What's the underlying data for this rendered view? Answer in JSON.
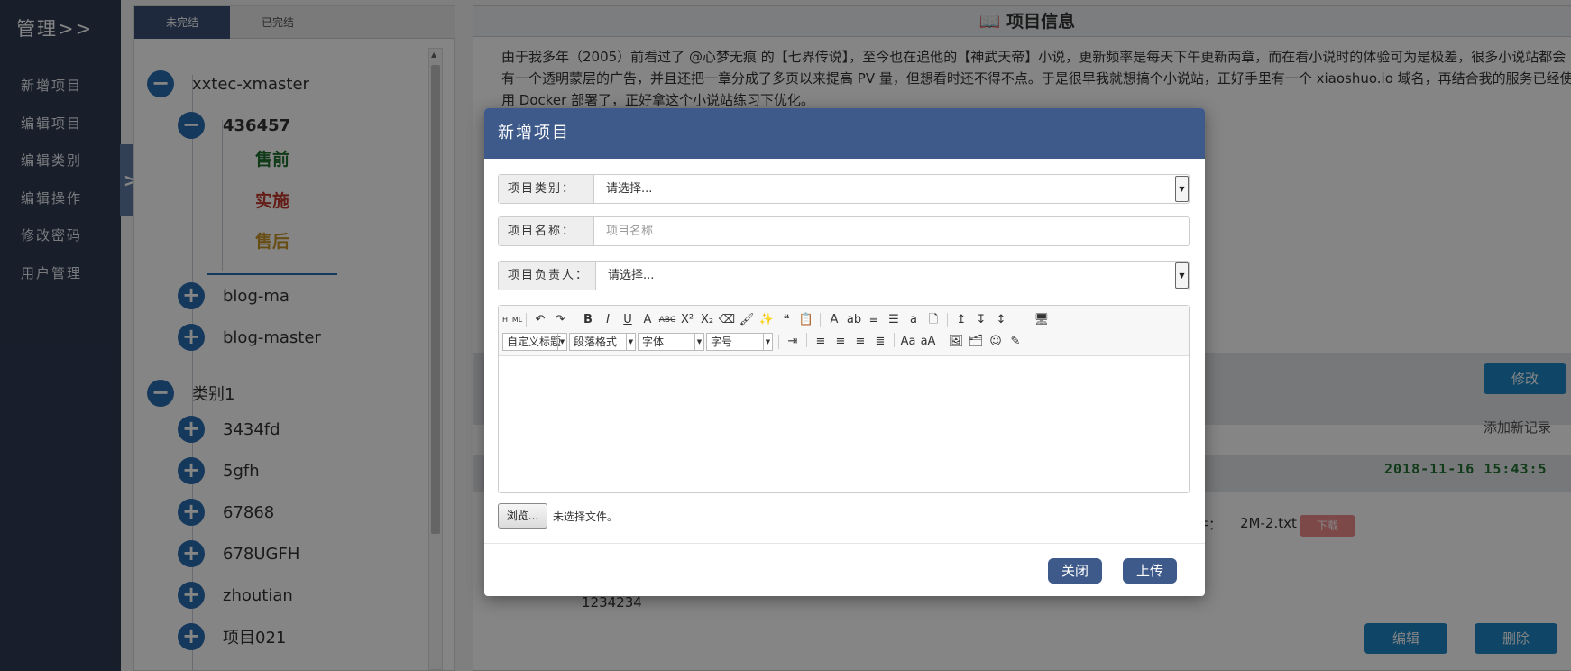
{
  "sidebar": {
    "brand": "管理>>",
    "items": [
      {
        "label": "新增项目"
      },
      {
        "label": "编辑项目"
      },
      {
        "label": "编辑类别"
      },
      {
        "label": "编辑操作"
      },
      {
        "label": "修改密码"
      },
      {
        "label": "用户管理"
      }
    ],
    "toggle_label": ">>"
  },
  "tree_panel": {
    "tabs": [
      {
        "label": "未完结",
        "active": true
      },
      {
        "label": "已完结",
        "active": false
      }
    ],
    "groups": [
      {
        "label": "xxtec-xmaster",
        "expanded": true
      },
      {
        "label": "436457",
        "expanded": true
      },
      {
        "label": "blog-ma"
      },
      {
        "label": "blog-master"
      },
      {
        "label": "类别1",
        "expanded": true
      },
      {
        "label": "3434fd"
      },
      {
        "label": "5gfh"
      },
      {
        "label": "67868"
      },
      {
        "label": "678UGFH"
      },
      {
        "label": "zhoutian"
      },
      {
        "label": "项目021"
      }
    ],
    "leaves": [
      {
        "label": "售前",
        "color": "#1f6f2f"
      },
      {
        "label": "实施",
        "color": "#c0392b"
      },
      {
        "label": "售后",
        "color": "#c8962a"
      }
    ],
    "collapse_glyph": "−",
    "expand_glyph": "+"
  },
  "main": {
    "title": "项目信息",
    "title_icon": "book-icon",
    "description": "由于我多年（2005）前看过了 @心梦无痕 的【七界传说】，至今也在追他的【神武天帝】小说，更新频率是每天下午更新两章，而在看小说时的体验可为是极差，很多小说站都会有一个透明蒙层的广告，并且还把一章分成了多页以来提高 PV 量，但想看时还不得不点。于是很早我就想搞个小说站，正好手里有一个 xiaoshuo.io 域名，再结合我的服务已经使用 Docker 部署了，正好拿这个小说站练习下优化。",
    "modify_button": "修改",
    "add_record_link": "添加新记录",
    "record_timestamp": "2018-11-16 15:43:5",
    "file_label": "件：",
    "file_name": "2M-2.txt",
    "download_badge": "下载",
    "record_text": "1234234",
    "edit_button": "编辑",
    "delete_button": "删除",
    "accent_color": "#1e87c6",
    "timestamp_color": "#1f6f2f"
  },
  "modal": {
    "title": "新增项目",
    "header_color": "#3d5a8a",
    "category": {
      "label": "项目类别：",
      "value": "请选择..."
    },
    "name": {
      "label": "项目名称：",
      "placeholder": "项目名称"
    },
    "owner": {
      "label": "项目负责人：",
      "value": "请选择..."
    },
    "editor": {
      "row1_icons": [
        "html-icon",
        "undo-icon",
        "redo-icon",
        "bold-icon",
        "italic-icon",
        "underline-icon",
        "font-border-icon",
        "strikethrough-icon",
        "superscript-icon",
        "subscript-icon",
        "eraser-icon",
        "format-brush-icon",
        "auto-format-icon",
        "blockquote-icon",
        "paste-text-icon",
        "forecolor-icon",
        "backcolor-icon",
        "ordered-list-icon",
        "unordered-list-icon",
        "anchor-icon",
        "new-page-icon",
        "row-spacing-top-icon",
        "row-spacing-bottom-icon",
        "line-height-icon",
        "fullscreen-icon"
      ],
      "row1_glyphs": [
        "HTML",
        "↶",
        "↷",
        "B",
        "I",
        "U",
        "A",
        "ABC",
        "X²",
        "X₂",
        "⌫",
        "🖌",
        "✨",
        "❝",
        "📋",
        "A",
        "ab",
        "≡",
        "☰",
        "a",
        "🗋",
        "↥",
        "↧",
        "↕",
        "🖥"
      ],
      "combos": [
        {
          "name": "custom-title-select",
          "label": "自定义标题"
        },
        {
          "name": "paragraph-format-select",
          "label": "段落格式"
        },
        {
          "name": "font-family-select",
          "label": "字体"
        },
        {
          "name": "font-size-select",
          "label": "字号"
        }
      ],
      "row2_icons": [
        "indent-icon",
        "align-left-icon",
        "align-center-icon",
        "align-right-icon",
        "align-justify-icon",
        "to-uppercase-icon",
        "to-lowercase-icon",
        "image-icon",
        "multi-image-icon",
        "emoticon-icon",
        "scrawl-icon"
      ],
      "row2_glyphs": [
        "⇥",
        "≡",
        "≡",
        "≡",
        "≣",
        "Aa",
        "aA",
        "🖼",
        "🗂",
        "☺",
        "✎"
      ]
    },
    "browse_button": "浏览...",
    "file_status": "未选择文件。",
    "close_button": "关闭",
    "upload_button": "上传"
  }
}
